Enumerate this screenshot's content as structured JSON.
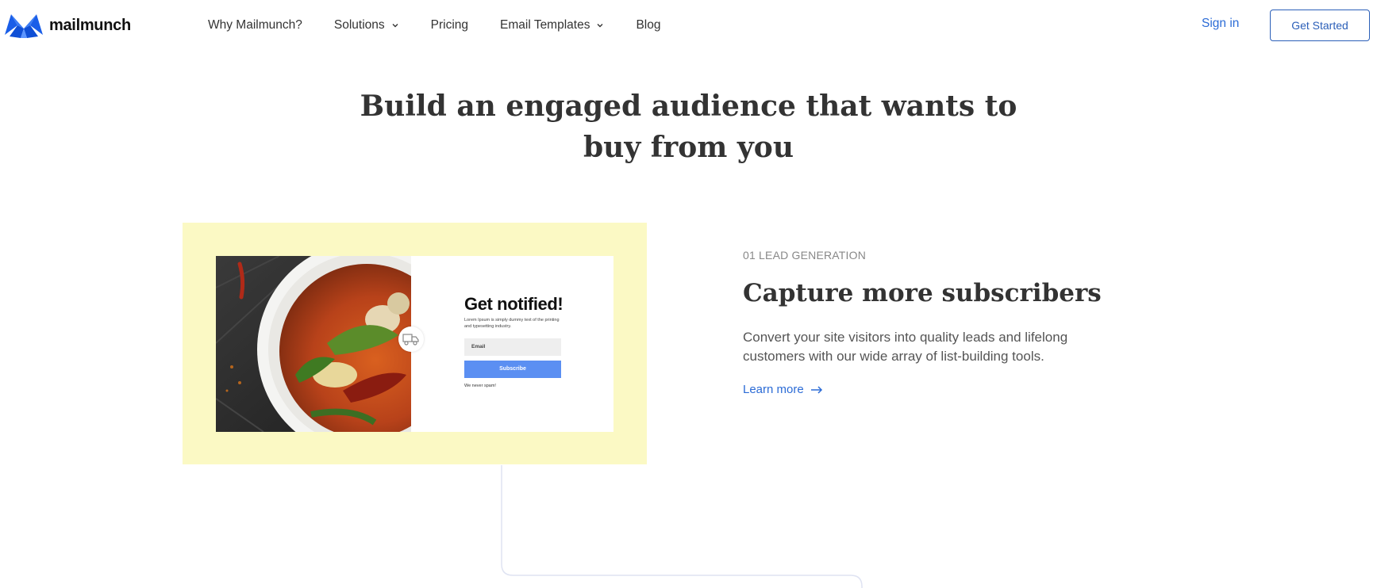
{
  "brand": {
    "name": "mailmunch",
    "color": "#2b6bd6"
  },
  "nav": {
    "items": [
      {
        "label": "Why Mailmunch?",
        "has_dropdown": false
      },
      {
        "label": "Solutions",
        "has_dropdown": true
      },
      {
        "label": "Pricing",
        "has_dropdown": false
      },
      {
        "label": "Email Templates",
        "has_dropdown": true
      },
      {
        "label": "Blog",
        "has_dropdown": false
      }
    ],
    "signin_label": "Sign in",
    "cta_label": "Get Started"
  },
  "hero": {
    "title_line1": "Build an engaged audience that wants to",
    "title_line2": "buy from you"
  },
  "feature": {
    "eyebrow": "01 LEAD GENERATION",
    "title": "Capture more subscribers",
    "description": "Convert your site visitors into quality leads and lifelong customers with our wide array of list-building tools.",
    "link_label": "Learn more",
    "card_bg": "#fbf9c4"
  },
  "form_preview": {
    "title": "Get notified!",
    "description": "Lorem Ipsum is simply dummy text of the printing and typesetting industry.",
    "email_placeholder": "Email",
    "button_label": "Subscribe",
    "note": "We never spam!",
    "button_color": "#5b8ff2"
  }
}
